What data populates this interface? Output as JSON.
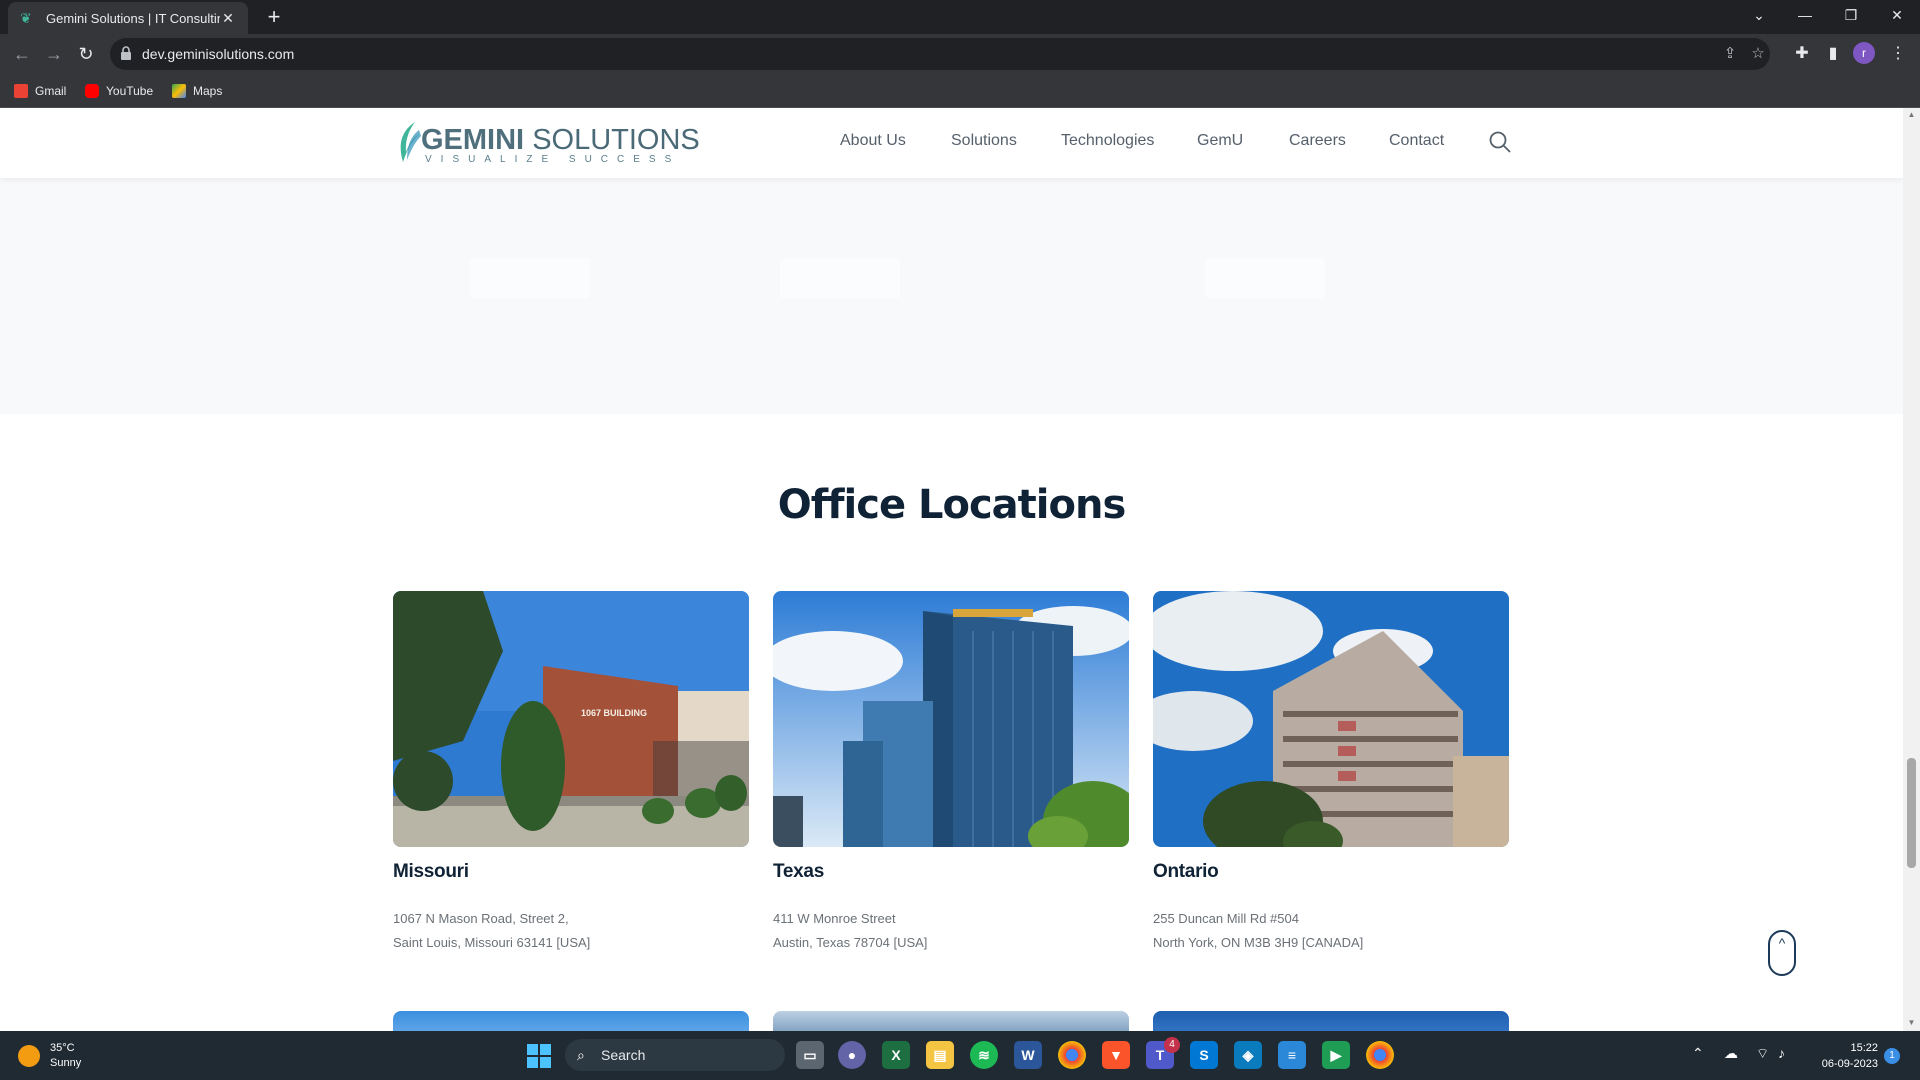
{
  "browser": {
    "tab_title": "Gemini Solutions | IT Consulting,",
    "tab_close": "✕",
    "new_tab": "+",
    "url": "dev.geminisolutions.com",
    "avatar_letter": "r"
  },
  "bookmarks": [
    {
      "label": "Gmail",
      "color": "#ea4335"
    },
    {
      "label": "YouTube",
      "color": "#ff0000"
    },
    {
      "label": "Maps",
      "color": "#34a853"
    }
  ],
  "site": {
    "logo_main": "GEMINI",
    "logo_second": "SOLUTIONS",
    "logo_tagline": "VISUALIZE SUCCESS",
    "nav": [
      "About Us",
      "Solutions",
      "Technologies",
      "GemU",
      "Careers",
      "Contact"
    ],
    "section_title": "Office Locations",
    "to_top_icon": "^"
  },
  "offices": [
    {
      "name": "Missouri",
      "address_line1": "1067 N Mason Road, Street 2,",
      "address_line2": "Saint Louis, Missouri 63141 [USA]",
      "building_sign": "1067 BUILDING"
    },
    {
      "name": "Texas",
      "address_line1": "411 W Monroe Street",
      "address_line2": "Austin, Texas 78704 [USA]"
    },
    {
      "name": "Ontario",
      "address_line1": "255 Duncan Mill Rd #504",
      "address_line2": "North York, ON M3B 3H9 [CANADA]"
    }
  ],
  "taskbar": {
    "temperature": "35°C",
    "weather": "Sunny",
    "search_label": "Search",
    "time": "15:22",
    "date": "06-09-2023",
    "notifications": "1",
    "teams_badge": "4"
  }
}
